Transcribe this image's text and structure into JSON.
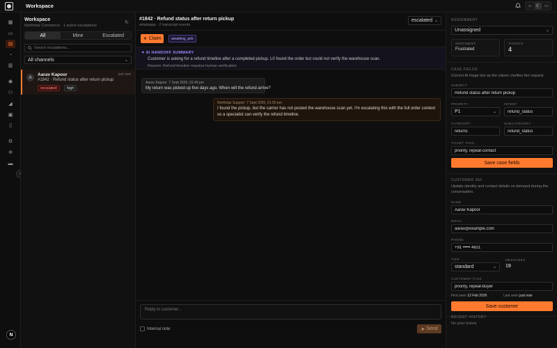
{
  "app": {
    "title": "Workspace"
  },
  "topbar": {
    "theme_icons": [
      "sun-icon",
      "moon-icon",
      "monitor-icon"
    ]
  },
  "rail": {
    "avatar_initial": "N"
  },
  "list": {
    "title": "Workspace",
    "subtitle": "Northstar Commerce · 1 active escalations",
    "tabs": [
      "All",
      "Mine",
      "Escalated"
    ],
    "active_tab": "All",
    "search_placeholder": "Search escalations...",
    "channel_filter": "All channels",
    "conversations": [
      {
        "initial": "A",
        "name": "Aarav Kapoor",
        "time": "just now",
        "subject": "#1842 · Refund status after return pickup",
        "badges": [
          "escalated",
          "high"
        ]
      }
    ]
  },
  "thread": {
    "title": "#1842 · Refund status after return pickup",
    "subtitle": "whatsapp · 2 transcript events",
    "status": "escalated",
    "claim_label": "Claim",
    "state_chip": "awaiting_ack",
    "handoff": {
      "title": "AI HANDOFF SUMMARY",
      "body": "Customer is asking for a refund timeline after a completed pickup. L0 found the order but could not verify the warehouse scan.",
      "reason": "Reason: Refund timeline requires human verification"
    },
    "messages": [
      {
        "author": "Aarav Kapoor",
        "time": "7 Sept 2026, 01:49 pm",
        "text": "My return was picked up five days ago. When will the refund arrive?"
      },
      {
        "author": "Northstar Support",
        "time": "7 Sept 2026, 01:50 pm",
        "text": "I found the pickup, but the carrier has not posted the warehouse scan yet. I'm escalating this with the full order context so a specialist can verify the refund timeline."
      }
    ],
    "compose_placeholder": "Reply to customer...",
    "internal_note_label": "Internal note",
    "send_label": "Send"
  },
  "side": {
    "assignment": {
      "label": "ASSIGNMENT",
      "value": "Unassigned"
    },
    "stats": [
      {
        "label": "SENTIMENT",
        "value": "Frustrated"
      },
      {
        "label": "TICKETS",
        "value": "4"
      }
    ],
    "case_fields": {
      "label": "CASE FIELDS",
      "description": "Correct AI triage live as the citizen clarifies the request.",
      "subject_label": "SUBJECT",
      "subject": "Refund status after return pickup",
      "priority_label": "PRIORITY",
      "priority": "P1",
      "intent_label": "INTENT",
      "intent": "refund_status",
      "category_label": "CATEGORY",
      "category": "returns",
      "subcategory_label": "SUBCATEGORY",
      "subcategory": "refund_status",
      "tags_label": "TICKET TAGS",
      "tags": "priority, repeat-contact",
      "save_label": "Save case fields"
    },
    "customer": {
      "label": "CUSTOMER 360",
      "description": "Update identity and contact details on demand during the conversation.",
      "name_label": "NAME",
      "name": "Aarav Kapoor",
      "email_label": "EMAIL",
      "email": "aarav@example.com",
      "phone_label": "PHONE",
      "phone": "+91 ••••• 4821",
      "tier_label": "TIER",
      "tier": "standard",
      "messages_label": "MESSAGES",
      "messages": "19",
      "tags_label": "CUSTOMER TAGS",
      "tags": "priority, repeat-buyer",
      "first_seen_label": "First seen",
      "first_seen": "12 Feb 2026",
      "last_seen_label": "Last seen",
      "last_seen": "just now",
      "save_label": "Save customer"
    },
    "history": {
      "label": "RECENT HISTORY",
      "empty": "No prior tickets"
    }
  },
  "colors": {
    "accent": "#ff7a2f",
    "escalated": "#ff8a7a",
    "ai": "#9a8cff",
    "background": "#0b0b0b"
  }
}
